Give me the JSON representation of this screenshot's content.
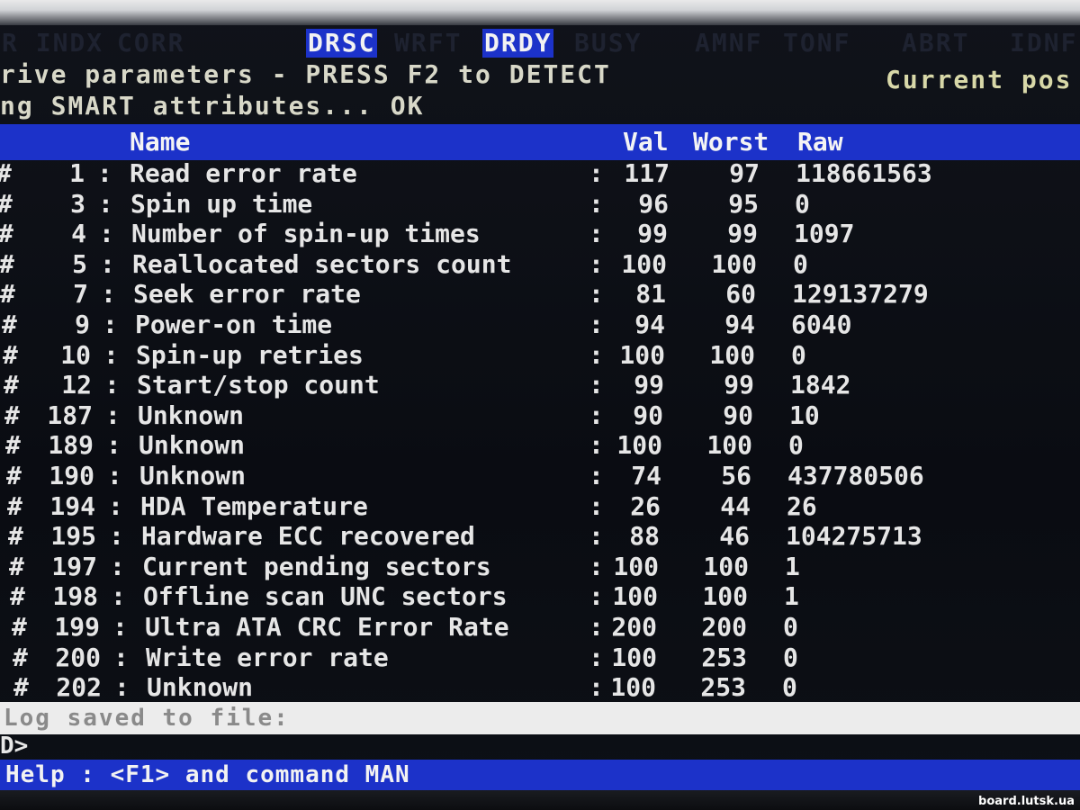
{
  "status_flags": [
    {
      "label": "R INDX",
      "active": false
    },
    {
      "label": "CORR",
      "active": false
    },
    {
      "label": "DRSC",
      "active": true
    },
    {
      "label": "WRFT",
      "active": false
    },
    {
      "label": "DRDY",
      "active": true
    },
    {
      "label": "BUSY",
      "active": false
    },
    {
      "label": "AMNF",
      "active": false
    },
    {
      "label": "TONF",
      "active": false
    },
    {
      "label": "ABRT",
      "active": false
    },
    {
      "label": "IDNF",
      "active": false
    }
  ],
  "drive_params_line": "rive parameters - PRESS F2 to DETECT",
  "current_pos_label": "Current pos",
  "smart_status_line": "ng SMART attributes... OK",
  "table": {
    "headers": {
      "name": "Name",
      "val": "Val",
      "worst": "Worst",
      "raw": "Raw"
    },
    "rows": [
      {
        "id": "1",
        "name": "Read error rate",
        "val": "117",
        "worst": "97",
        "raw": "118661563"
      },
      {
        "id": "3",
        "name": "Spin up time",
        "val": "96",
        "worst": "95",
        "raw": "0"
      },
      {
        "id": "4",
        "name": "Number of spin-up times",
        "val": "99",
        "worst": "99",
        "raw": "1097"
      },
      {
        "id": "5",
        "name": "Reallocated sectors count",
        "val": "100",
        "worst": "100",
        "raw": "0"
      },
      {
        "id": "7",
        "name": "Seek error rate",
        "val": "81",
        "worst": "60",
        "raw": "129137279"
      },
      {
        "id": "9",
        "name": "Power-on time",
        "val": "94",
        "worst": "94",
        "raw": "6040"
      },
      {
        "id": "10",
        "name": "Spin-up retries",
        "val": "100",
        "worst": "100",
        "raw": "0"
      },
      {
        "id": "12",
        "name": "Start/stop count",
        "val": "99",
        "worst": "99",
        "raw": "1842"
      },
      {
        "id": "187",
        "name": "Unknown",
        "val": "90",
        "worst": "90",
        "raw": "10"
      },
      {
        "id": "189",
        "name": "Unknown",
        "val": "100",
        "worst": "100",
        "raw": "0"
      },
      {
        "id": "190",
        "name": "Unknown",
        "val": "74",
        "worst": "56",
        "raw": "437780506"
      },
      {
        "id": "194",
        "name": "HDA Temperature",
        "val": "26",
        "worst": "44",
        "raw": "26"
      },
      {
        "id": "195",
        "name": "Hardware ECC recovered",
        "val": "88",
        "worst": "46",
        "raw": "104275713"
      },
      {
        "id": "197",
        "name": "Current pending sectors",
        "val": "100",
        "worst": "100",
        "raw": "1"
      },
      {
        "id": "198",
        "name": "Offline scan UNC sectors",
        "val": "100",
        "worst": "100",
        "raw": "1"
      },
      {
        "id": "199",
        "name": "Ultra ATA CRC Error Rate",
        "val": "200",
        "worst": "200",
        "raw": "0"
      },
      {
        "id": "200",
        "name": "Write error rate",
        "val": "100",
        "worst": "253",
        "raw": "0"
      },
      {
        "id": "202",
        "name": "Unknown",
        "val": "100",
        "worst": "253",
        "raw": "0"
      }
    ]
  },
  "row_marker": "#",
  "separator": ":",
  "log_line": "Log saved to file:",
  "prompt": "D>",
  "help_line": "Help : <F1> and command MAN",
  "watermark": "board.lutsk.ua",
  "colors": {
    "highlight_blue": "#1c32c9",
    "background": "#0b0d12",
    "text": "#e8e8e8"
  }
}
